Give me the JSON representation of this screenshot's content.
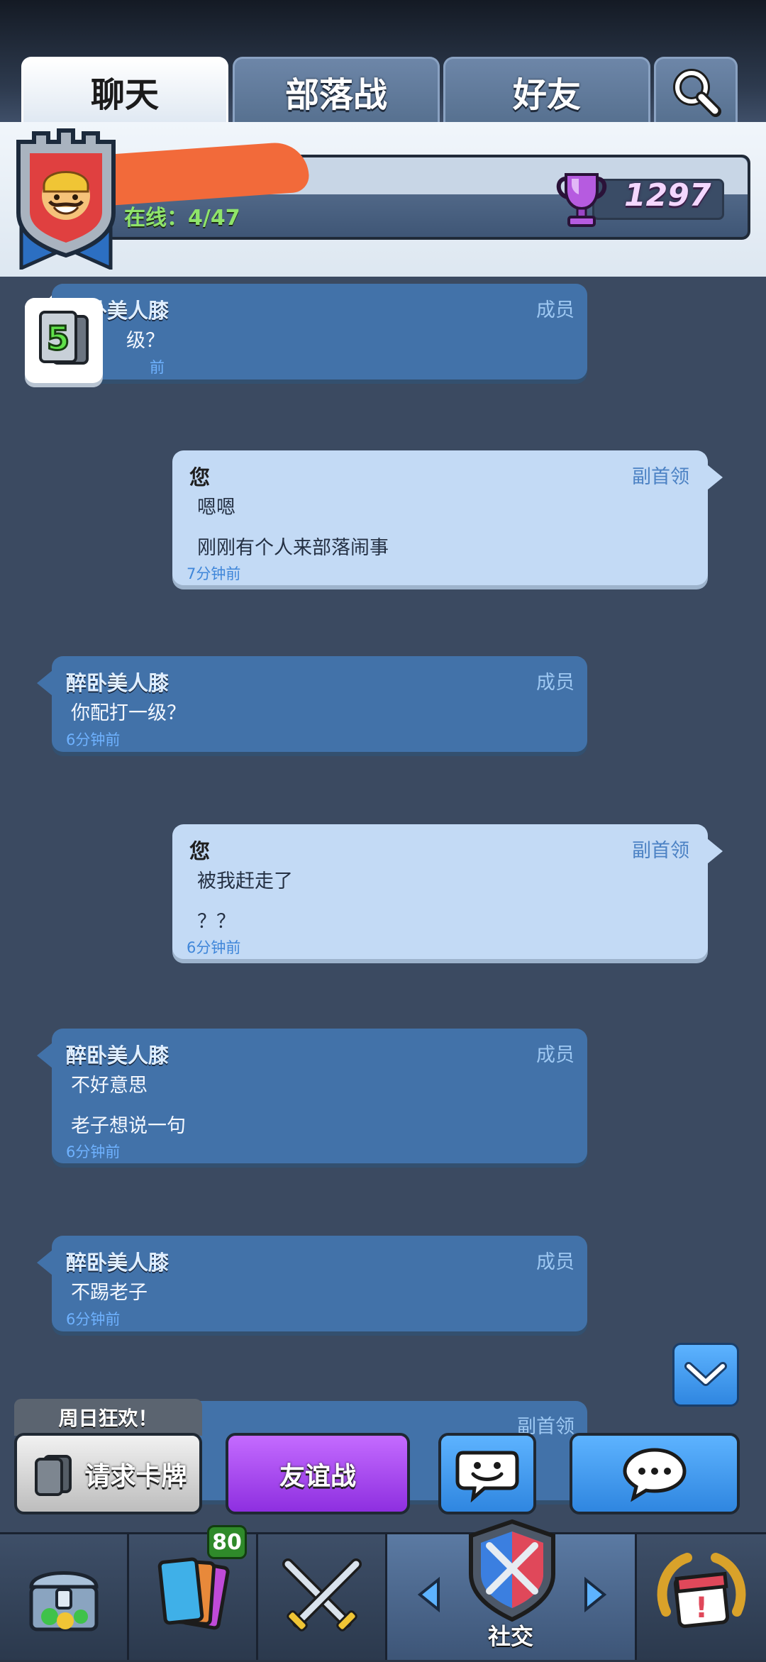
{
  "tabs": [
    {
      "label": "聊天",
      "active": true
    },
    {
      "label": "部落战",
      "active": false
    },
    {
      "label": "好友",
      "active": false
    }
  ],
  "clan": {
    "online_label": "在线：4/47",
    "trophies": "1297"
  },
  "card_counter": "5",
  "messages": [
    {
      "sender": "醉卧美人膝",
      "role": "成员",
      "lines": [
        "级？"
      ],
      "time": "前"
    },
    {
      "sender": "您",
      "role": "副首领",
      "lines": [
        "嗯嗯",
        "刚刚有个人来部落闹事"
      ],
      "time": "7分钟前"
    },
    {
      "sender": "醉卧美人膝",
      "role": "成员",
      "lines": [
        "你配打一级？"
      ],
      "time": "6分钟前"
    },
    {
      "sender": "您",
      "role": "副首领",
      "lines": [
        "被我赶走了",
        "？？"
      ],
      "time": "6分钟前"
    },
    {
      "sender": "醉卧美人膝",
      "role": "成员",
      "lines": [
        "不好意思",
        "老子想说一句"
      ],
      "time": "6分钟前"
    },
    {
      "sender": "醉卧美人膝",
      "role": "成员",
      "lines": [
        "不踢老子"
      ],
      "time": "6分钟前"
    },
    {
      "sender": "",
      "role": "副首领",
      "lines": [],
      "time": ""
    }
  ],
  "actions": {
    "sunday_label": "周日狂欢！",
    "request_cards": "请求卡牌",
    "friendly_battle": "友谊战"
  },
  "nav": {
    "cards_badge": "80",
    "social_label": "社交"
  },
  "colors": {
    "background": "#3b4a61",
    "other_bubble": "#4272a9",
    "my_bubble": "#c3daf5",
    "friendly_purple": "#a64ff0",
    "blue_button": "#3d98f0"
  }
}
